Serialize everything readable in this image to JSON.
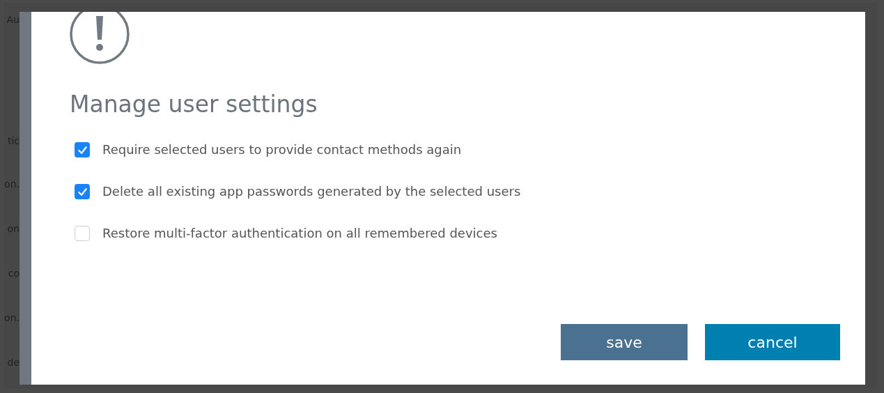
{
  "background_page": {
    "fragments": [
      "Au",
      "tic",
      "on.",
      "on",
      "co",
      "on.",
      "de"
    ]
  },
  "dialog": {
    "title": "Manage user settings",
    "options": [
      {
        "label": "Require selected users to provide contact methods again",
        "checked": true
      },
      {
        "label": "Delete all existing app passwords generated by the selected users",
        "checked": true
      },
      {
        "label": "Restore multi-factor authentication on all remembered devices",
        "checked": false
      }
    ],
    "buttons": [
      {
        "label": "save",
        "kind": "primary"
      },
      {
        "label": "cancel",
        "kind": "secondary"
      }
    ]
  }
}
